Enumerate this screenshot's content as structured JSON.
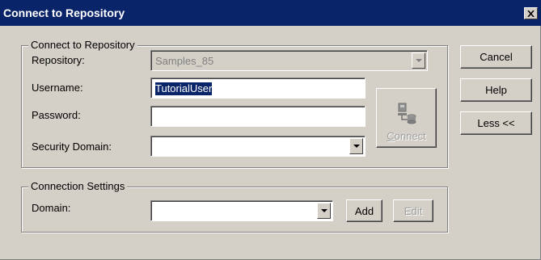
{
  "window": {
    "title": "Connect to Repository",
    "close_glyph": "✕"
  },
  "connect_group": {
    "legend": "Connect to Repository",
    "repository_label": "Repository:",
    "repository_value": "Samples_85",
    "username_label": "Username:",
    "username_value": "TutorialUser",
    "password_label": "Password:",
    "password_value": "",
    "security_domain_label": "Security Domain:",
    "security_domain_value": "",
    "connect_button": {
      "label_first": "C",
      "label_rest": "onnect",
      "icon": "repository-connect-icon"
    }
  },
  "side_buttons": {
    "cancel": "Cancel",
    "help": "Help",
    "less": "Less <<"
  },
  "settings_group": {
    "legend": "Connection Settings",
    "domain_label": "Domain:",
    "domain_value": "",
    "add_button": "Add",
    "edit_button": "Edit"
  }
}
